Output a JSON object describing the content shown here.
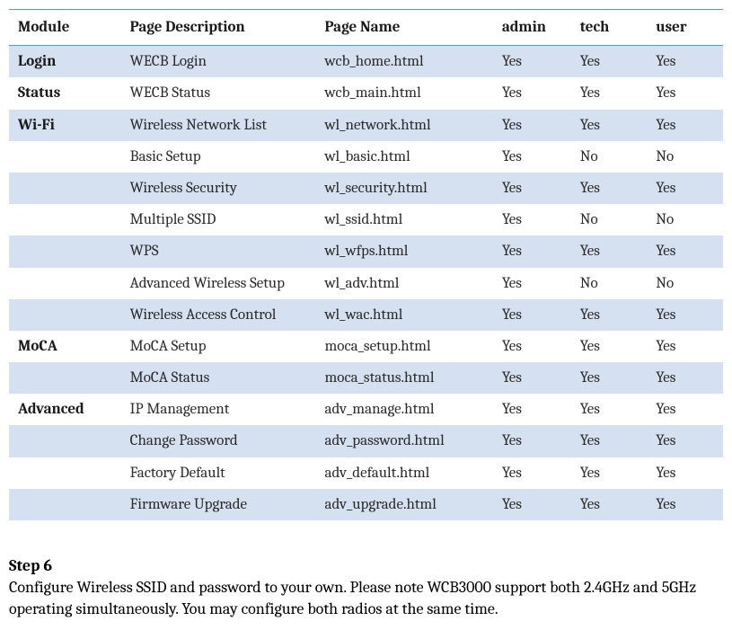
{
  "table": {
    "headers": [
      "Module",
      "Page Description",
      "Page Name",
      "admin",
      "tech",
      "user"
    ],
    "rows": [
      {
        "module": "Login",
        "desc": "WECB Login",
        "desc_red": false,
        "page": "wcb_home.html",
        "admin": "Yes",
        "admin_red": false,
        "tech": "Yes",
        "tech_red": false,
        "user": "Yes",
        "user_red": false,
        "shaded": true
      },
      {
        "module": "Status",
        "desc": "WECB Status",
        "desc_red": false,
        "page": "wcb_main.html",
        "admin": "Yes",
        "admin_red": false,
        "tech": "Yes",
        "tech_red": false,
        "user": "Yes",
        "user_red": false,
        "shaded": false
      },
      {
        "module": "Wi-Fi",
        "desc": "Wireless Network List",
        "desc_red": true,
        "page": "wl_network.html",
        "admin": "Yes",
        "admin_red": false,
        "tech": "Yes",
        "tech_red": false,
        "user": "Yes",
        "user_red": false,
        "shaded": true
      },
      {
        "module": "",
        "desc": "Basic Setup",
        "desc_red": false,
        "page": "wl_basic.html",
        "admin": "Yes",
        "admin_red": false,
        "tech": "No",
        "tech_red": true,
        "user": "No",
        "user_red": true,
        "shaded": false
      },
      {
        "module": "",
        "desc": "Wireless Security",
        "desc_red": true,
        "page": "wl_security.html",
        "admin": "Yes",
        "admin_red": false,
        "tech": "Yes",
        "tech_red": false,
        "user": "Yes",
        "user_red": false,
        "shaded": true
      },
      {
        "module": "",
        "desc": "Multiple SSID",
        "desc_red": false,
        "page": "wl_ssid.html",
        "admin": "Yes",
        "admin_red": false,
        "tech": "No",
        "tech_red": true,
        "user": "No",
        "user_red": true,
        "shaded": false
      },
      {
        "module": "",
        "desc": "WPS",
        "desc_red": true,
        "page": "wl_wfps.html",
        "admin": "Yes",
        "admin_red": false,
        "tech": "Yes",
        "tech_red": false,
        "user": "Yes",
        "user_red": false,
        "shaded": true
      },
      {
        "module": "",
        "desc": "Advanced Wireless Setup",
        "desc_red": false,
        "page": "wl_adv.html",
        "admin": "Yes",
        "admin_red": false,
        "tech": "No",
        "tech_red": true,
        "user": "No",
        "user_red": true,
        "shaded": false
      },
      {
        "module": "",
        "desc": "Wireless Access Control",
        "desc_red": false,
        "page": "wl_wac.html",
        "admin": "Yes",
        "admin_red": false,
        "tech": "Yes",
        "tech_red": false,
        "user": "Yes",
        "user_red": false,
        "shaded": true
      },
      {
        "module": "MoCA",
        "desc": "MoCA Setup",
        "desc_red": true,
        "page": "moca_setup.html",
        "admin": "Yes",
        "admin_red": false,
        "tech": "Yes",
        "tech_red": false,
        "user": "Yes",
        "user_red": false,
        "shaded": false
      },
      {
        "module": "",
        "desc": "MoCA Status",
        "desc_red": false,
        "page": "moca_status.html",
        "admin": "Yes",
        "admin_red": false,
        "tech": "Yes",
        "tech_red": false,
        "user": "Yes",
        "user_red": false,
        "shaded": true
      },
      {
        "module": "Advanced",
        "desc": "IP Management",
        "desc_red": false,
        "page": "adv_manage.html",
        "admin": "Yes",
        "admin_red": false,
        "tech": "Yes",
        "tech_red": false,
        "user": "Yes",
        "user_red": false,
        "shaded": false
      },
      {
        "module": "",
        "desc": "Change Password",
        "desc_red": false,
        "page": "adv_password.html",
        "admin": "Yes",
        "admin_red": false,
        "tech": "Yes",
        "tech_red": false,
        "user": "Yes",
        "user_red": false,
        "shaded": true
      },
      {
        "module": "",
        "desc": "Factory Default",
        "desc_red": false,
        "page": "adv_default.html",
        "admin": "Yes",
        "admin_red": false,
        "tech": "Yes",
        "tech_red": false,
        "user": "Yes",
        "user_red": false,
        "shaded": false
      },
      {
        "module": "",
        "desc": "Firmware Upgrade",
        "desc_red": false,
        "page": "adv_upgrade.html",
        "admin": "Yes",
        "admin_red": false,
        "tech": "Yes",
        "tech_red": false,
        "user": "Yes",
        "user_red": false,
        "shaded": true
      }
    ]
  },
  "step": {
    "heading": "Step 6",
    "text": "Configure Wireless SSID and password to your own. Please note WCB3000 support both 2.4GHz and 5GHz operating simultaneously. You may configure both radios at the same time."
  }
}
